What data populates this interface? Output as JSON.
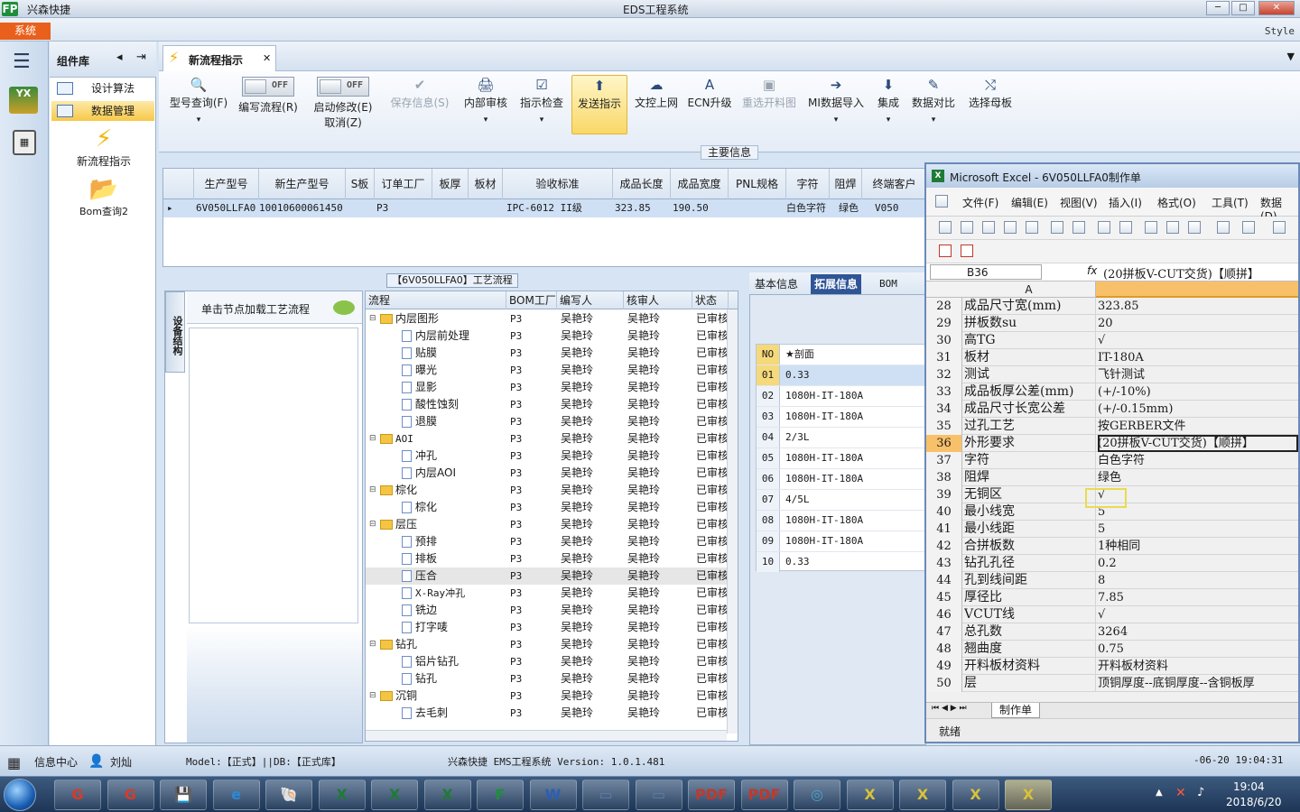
{
  "app": {
    "logo": "FP",
    "name": "兴森快捷",
    "window_title": "EDS工程系统",
    "menu_system": "系统",
    "style_label": "Style",
    "win_min": "─",
    "win_max": "□",
    "win_close": "✕"
  },
  "leftnav": {
    "hamburger": "☰",
    "icon1": "YX"
  },
  "complib": {
    "title": "组件库",
    "arrow": "◂",
    "pin": "⇥",
    "items": [
      {
        "label": "设计算法"
      },
      {
        "label": "数据管理"
      }
    ],
    "tools": [
      {
        "glyph": "⚡",
        "label": "新流程指示"
      },
      {
        "glyph": "📂",
        "label": "Bom查询2"
      }
    ]
  },
  "tab": {
    "icon": "⚡",
    "label": "新流程指示",
    "close": "✕",
    "dropdown": "▼"
  },
  "toolbar": {
    "model_query": {
      "glyph": "🔍",
      "label": "型号查询(F)"
    },
    "edit_flow": {
      "state": "OFF",
      "label": "编写流程(R)"
    },
    "enable_edit": {
      "state": "OFF",
      "label": "启动修改(E)",
      "sub": "取消(Z)"
    },
    "save_info": {
      "glyph": "✔",
      "label": "保存信息(S)"
    },
    "internal_review": {
      "glyph": "🖨",
      "label": "内部审核"
    },
    "instruction_check": {
      "glyph": "☑",
      "label": "指示检查"
    },
    "send_instruction": {
      "glyph": "⬆",
      "label": "发送指示"
    },
    "doc_upload": {
      "glyph": "☁",
      "label": "文控上网"
    },
    "ecn_upgrade": {
      "glyph": "A",
      "label": "ECN升级"
    },
    "reselect_material": {
      "glyph": "▣",
      "label": "重选开料图"
    },
    "mi_import": {
      "glyph": "➔",
      "label": "MI数据导入"
    },
    "integrate": {
      "glyph": "⬇",
      "label": "集成"
    },
    "data_compare": {
      "glyph": "✎",
      "label": "数据对比"
    },
    "select_master": {
      "glyph": "⤭",
      "label": "选择母板"
    },
    "dropdown": "▾",
    "group_label": "主要信息"
  },
  "maingrid": {
    "columns": [
      "生产型号",
      "新生产型号",
      "S板",
      "订单工厂",
      "板厚",
      "板材",
      "验收标准",
      "成品长度",
      "成品宽度",
      "PNL规格",
      "字符",
      "阻焊",
      "终端客户"
    ],
    "row_marker": "▸",
    "row": [
      "6V050LLFA0",
      "10010600061450",
      "",
      "P3",
      "",
      "",
      "IPC-6012 II级",
      "323.85",
      "190.50",
      "",
      "白色字符",
      "绿色",
      "V050"
    ]
  },
  "process": {
    "title": "【6V050LLFA0】工艺流程",
    "vtab": "设备结构",
    "node_hint": "单击节点加载工艺流程",
    "tree_columns": [
      "流程",
      "BOM工厂",
      "编写人",
      "核审人",
      "状态"
    ],
    "tree_rows": [
      {
        "name": "内层图形",
        "level": 0,
        "folder": true,
        "bom": "P3",
        "writer": "吴艳玲",
        "reviewer": "吴艳玲",
        "status": "已审核"
      },
      {
        "name": "内层前处理",
        "level": 1,
        "folder": false,
        "bom": "P3",
        "writer": "吴艳玲",
        "reviewer": "吴艳玲",
        "status": "已审核"
      },
      {
        "name": "贴膜",
        "level": 1,
        "folder": false,
        "bom": "P3",
        "writer": "吴艳玲",
        "reviewer": "吴艳玲",
        "status": "已审核"
      },
      {
        "name": "曝光",
        "level": 1,
        "folder": false,
        "bom": "P3",
        "writer": "吴艳玲",
        "reviewer": "吴艳玲",
        "status": "已审核"
      },
      {
        "name": "显影",
        "level": 1,
        "folder": false,
        "bom": "P3",
        "writer": "吴艳玲",
        "reviewer": "吴艳玲",
        "status": "已审核"
      },
      {
        "name": "酸性蚀刻",
        "level": 1,
        "folder": false,
        "bom": "P3",
        "writer": "吴艳玲",
        "reviewer": "吴艳玲",
        "status": "已审核"
      },
      {
        "name": "退膜",
        "level": 1,
        "folder": false,
        "bom": "P3",
        "writer": "吴艳玲",
        "reviewer": "吴艳玲",
        "status": "已审核"
      },
      {
        "name": "AOI",
        "level": 0,
        "folder": true,
        "bom": "P3",
        "writer": "吴艳玲",
        "reviewer": "吴艳玲",
        "status": "已审核"
      },
      {
        "name": "冲孔",
        "level": 1,
        "folder": false,
        "bom": "P3",
        "writer": "吴艳玲",
        "reviewer": "吴艳玲",
        "status": "已审核"
      },
      {
        "name": "内层AOI",
        "level": 1,
        "folder": false,
        "bom": "P3",
        "writer": "吴艳玲",
        "reviewer": "吴艳玲",
        "status": "已审核"
      },
      {
        "name": "棕化",
        "level": 0,
        "folder": true,
        "bom": "P3",
        "writer": "吴艳玲",
        "reviewer": "吴艳玲",
        "status": "已审核"
      },
      {
        "name": "棕化",
        "level": 1,
        "folder": false,
        "bom": "P3",
        "writer": "吴艳玲",
        "reviewer": "吴艳玲",
        "status": "已审核"
      },
      {
        "name": "层压",
        "level": 0,
        "folder": true,
        "bom": "P3",
        "writer": "吴艳玲",
        "reviewer": "吴艳玲",
        "status": "已审核"
      },
      {
        "name": "预排",
        "level": 1,
        "folder": false,
        "bom": "P3",
        "writer": "吴艳玲",
        "reviewer": "吴艳玲",
        "status": "已审核"
      },
      {
        "name": "排板",
        "level": 1,
        "folder": false,
        "bom": "P3",
        "writer": "吴艳玲",
        "reviewer": "吴艳玲",
        "status": "已审核"
      },
      {
        "name": "压合",
        "level": 1,
        "folder": false,
        "bom": "P3",
        "writer": "吴艳玲",
        "reviewer": "吴艳玲",
        "status": "已审核",
        "selected": true
      },
      {
        "name": "X-Ray冲孔",
        "level": 1,
        "folder": false,
        "bom": "P3",
        "writer": "吴艳玲",
        "reviewer": "吴艳玲",
        "status": "已审核"
      },
      {
        "name": "铣边",
        "level": 1,
        "folder": false,
        "bom": "P3",
        "writer": "吴艳玲",
        "reviewer": "吴艳玲",
        "status": "已审核"
      },
      {
        "name": "打字唛",
        "level": 1,
        "folder": false,
        "bom": "P3",
        "writer": "吴艳玲",
        "reviewer": "吴艳玲",
        "status": "已审核"
      },
      {
        "name": "钻孔",
        "level": 0,
        "folder": true,
        "bom": "P3",
        "writer": "吴艳玲",
        "reviewer": "吴艳玲",
        "status": "已审核"
      },
      {
        "name": "铝片钻孔",
        "level": 1,
        "folder": false,
        "bom": "P3",
        "writer": "吴艳玲",
        "reviewer": "吴艳玲",
        "status": "已审核"
      },
      {
        "name": "钻孔",
        "level": 1,
        "folder": false,
        "bom": "P3",
        "writer": "吴艳玲",
        "reviewer": "吴艳玲",
        "status": "已审核"
      },
      {
        "name": "沉铜",
        "level": 0,
        "folder": true,
        "bom": "P3",
        "writer": "吴艳玲",
        "reviewer": "吴艳玲",
        "status": "已审核"
      },
      {
        "name": "去毛刺",
        "level": 1,
        "folder": false,
        "bom": "P3",
        "writer": "吴艳玲",
        "reviewer": "吴艳玲",
        "status": "已审核"
      }
    ]
  },
  "rightpanel": {
    "tabs": [
      "基本信息",
      "拓展信息",
      "BOM"
    ],
    "head_no": "NO",
    "head_val": "★剖面",
    "rows": [
      {
        "no": "01",
        "val": "0.33"
      },
      {
        "no": "02",
        "val": "1080H-IT-180A"
      },
      {
        "no": "03",
        "val": "1080H-IT-180A"
      },
      {
        "no": "04",
        "val": "2/3L"
      },
      {
        "no": "05",
        "val": "1080H-IT-180A"
      },
      {
        "no": "06",
        "val": "1080H-IT-180A"
      },
      {
        "no": "07",
        "val": "4/5L"
      },
      {
        "no": "08",
        "val": "1080H-IT-180A"
      },
      {
        "no": "09",
        "val": "1080H-IT-180A"
      },
      {
        "no": "10",
        "val": "0.33"
      }
    ]
  },
  "excel": {
    "title": "Microsoft Excel - 6V050LLFA0制作单",
    "menus": [
      "文件(F)",
      "编辑(E)",
      "视图(V)",
      "插入(I)",
      "格式(O)",
      "工具(T)",
      "数据(D)"
    ],
    "namebox": "B36",
    "fx": "fx",
    "formula": "(20拼板V-CUT交货)【顺拼】",
    "col_a": "A",
    "rows": [
      {
        "n": "28",
        "a": "成品尺寸宽(mm)",
        "b": "323.85"
      },
      {
        "n": "29",
        "a": "拼板数su",
        "b": "20"
      },
      {
        "n": "30",
        "a": "高TG",
        "b": "√"
      },
      {
        "n": "31",
        "a": "板材",
        "b": "IT-180A"
      },
      {
        "n": "32",
        "a": "测试",
        "b": "飞针测试"
      },
      {
        "n": "33",
        "a": "成品板厚公差(mm)",
        "b": "(+/-10%)"
      },
      {
        "n": "34",
        "a": "成品尺寸长宽公差",
        "b": "(+/-0.15mm)"
      },
      {
        "n": "35",
        "a": "过孔工艺",
        "b": "按GERBER文件"
      },
      {
        "n": "36",
        "a": "外形要求",
        "b": "(20拼板V-CUT交货)【顺拼】",
        "selected": true
      },
      {
        "n": "37",
        "a": "字符",
        "b": "白色字符"
      },
      {
        "n": "38",
        "a": "阻焊",
        "b": "绿色"
      },
      {
        "n": "39",
        "a": "无铜区",
        "b": "√"
      },
      {
        "n": "40",
        "a": "最小线宽",
        "b": "5"
      },
      {
        "n": "41",
        "a": "最小线距",
        "b": "5"
      },
      {
        "n": "42",
        "a": "合拼板数",
        "b": "1种相同"
      },
      {
        "n": "43",
        "a": "钻孔孔径",
        "b": "0.2"
      },
      {
        "n": "44",
        "a": "孔到线间距",
        "b": "8"
      },
      {
        "n": "45",
        "a": "厚径比",
        "b": "7.85"
      },
      {
        "n": "46",
        "a": "VCUT线",
        "b": "√"
      },
      {
        "n": "47",
        "a": "总孔数",
        "b": "3264"
      },
      {
        "n": "48",
        "a": "翘曲度",
        "b": "0.75"
      },
      {
        "n": "49",
        "a": "开料板材资料",
        "b": "开料板材资料"
      },
      {
        "n": "50",
        "a": "层",
        "b": "顶铜厚度--底铜厚度--含铜板厚"
      }
    ],
    "sheet_nav": "⏮ ◀ ▶ ⏭",
    "sheet_tab": "制作单",
    "status": "就绪"
  },
  "statusbar": {
    "info_center": "信息中心",
    "user": "刘灿",
    "model": "Model:【正式】||DB:【正式库】",
    "version": "兴森快捷 EMS工程系统 Version: 1.0.1.481",
    "datetime": "-06-20 19:04:31"
  },
  "taskbar": {
    "apps": [
      "G",
      "G",
      "💾",
      "e",
      "🐚",
      "X",
      "X",
      "X",
      "F",
      "W",
      "▭",
      "▭",
      "PDF",
      "PDF",
      "◎",
      "X",
      "X",
      "X",
      "X"
    ],
    "tray_up": "▲",
    "time": "19:04",
    "date": "2018/6/20"
  }
}
